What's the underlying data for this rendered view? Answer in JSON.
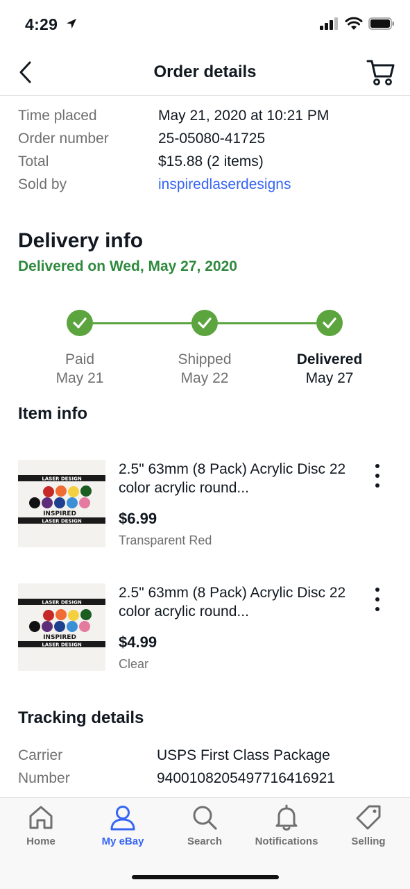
{
  "status_bar": {
    "time": "4:29"
  },
  "header": {
    "title": "Order details"
  },
  "summary": [
    {
      "label": "Time placed",
      "value": "May 21, 2020 at 10:21 PM"
    },
    {
      "label": "Order number",
      "value": "25-05080-41725"
    },
    {
      "label": "Total",
      "value": "$15.88 (2 items)"
    },
    {
      "label": "Sold by",
      "value": "inspiredlaserdesigns"
    }
  ],
  "delivery": {
    "title": "Delivery info",
    "status": "Delivered on Wed, May 27, 2020",
    "steps": [
      {
        "label": "Paid",
        "date": "May 21"
      },
      {
        "label": "Shipped",
        "date": "May 22"
      },
      {
        "label": "Delivered",
        "date": "May 27"
      }
    ]
  },
  "items_section": {
    "title": "Item info"
  },
  "items": [
    {
      "name": "2.5\"  63mm (8 Pack) Acrylic Disc 22 color acrylic round...",
      "price": "$6.99",
      "variant": "Transparent Red"
    },
    {
      "name": "2.5\"  63mm (8 Pack) Acrylic Disc 22 color acrylic round...",
      "price": "$4.99",
      "variant": "Clear"
    }
  ],
  "thumb_banner": "LASER DESIGN",
  "thumb_brand": "INSPIRED",
  "tracking": {
    "title": "Tracking details",
    "rows": [
      {
        "label": "Carrier",
        "value": "USPS First Class Package"
      },
      {
        "label": "Number",
        "value": "9400108205497716416921"
      }
    ]
  },
  "tabs": [
    {
      "label": "Home",
      "icon": "home-icon"
    },
    {
      "label": "My eBay",
      "icon": "person-icon"
    },
    {
      "label": "Search",
      "icon": "search-icon"
    },
    {
      "label": "Notifications",
      "icon": "bell-icon"
    },
    {
      "label": "Selling",
      "icon": "tag-icon"
    }
  ],
  "colors": {
    "accent": "#3665f3",
    "success": "#2f8a3e",
    "progress": "#5ba43e",
    "muted": "#707070"
  }
}
